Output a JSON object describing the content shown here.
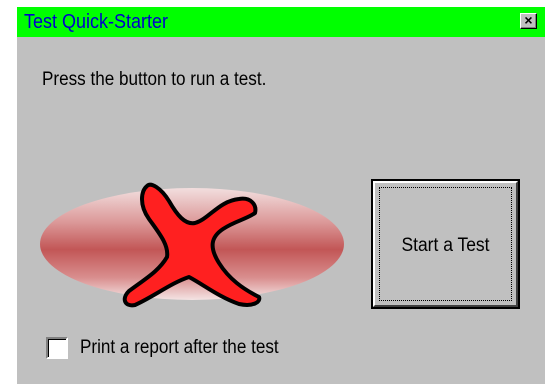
{
  "window": {
    "title": "Test Quick-Starter",
    "close_glyph": "×",
    "titlebar_color": "#00ff00",
    "title_color": "#0000cc"
  },
  "main": {
    "instructions": "Press the button to run a test.",
    "status_icon": "red-x-icon",
    "status_colors": {
      "ellipse": "#c85a5a",
      "x_mark": "#ff2020"
    },
    "start_button_label": "Start a Test",
    "print_report": {
      "label": "Print a report after the test",
      "checked": false
    }
  }
}
